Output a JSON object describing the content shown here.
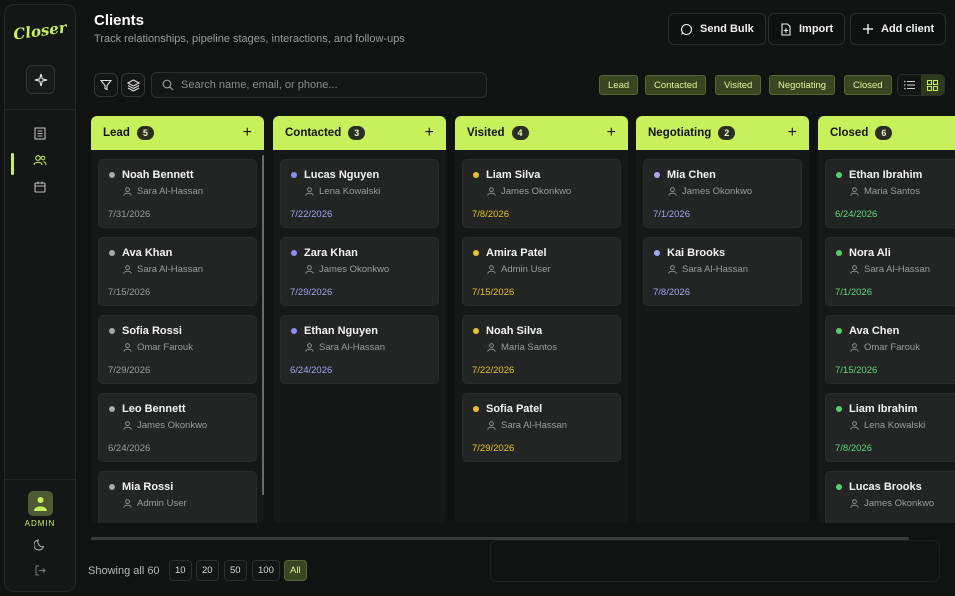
{
  "app": {
    "logo": "Closer"
  },
  "sidebar": {
    "user_role": "ADMIN"
  },
  "header": {
    "title": "Clients",
    "subtitle": "Track relationships, pipeline stages, interactions, and follow-ups",
    "buttons": {
      "send_bulk": "Send Bulk",
      "import": "Import",
      "add_client": "Add client"
    }
  },
  "toolbar": {
    "search_placeholder": "Search name, email, or phone...",
    "filters": [
      "Lead",
      "Contacted",
      "Visited",
      "Negotiating",
      "Closed"
    ]
  },
  "colors": {
    "accent": "#c8f05a",
    "lead": "#a8aaaa",
    "contacted": "#8b8ff0",
    "visited": "#e8c227",
    "negotiating": "#a0a8ee",
    "closed": "#4fd06a"
  },
  "columns": [
    {
      "title": "Lead",
      "count": "5",
      "cards": [
        {
          "name": "Noah Bennett",
          "owner": "Sara Al-Hassan",
          "date": "7/31/2026"
        },
        {
          "name": "Ava Khan",
          "owner": "Sara Al-Hassan",
          "date": "7/15/2026"
        },
        {
          "name": "Sofia Rossi",
          "owner": "Omar Farouk",
          "date": "7/29/2026"
        },
        {
          "name": "Leo Bennett",
          "owner": "James Okonkwo",
          "date": "6/24/2026"
        },
        {
          "name": "Mia Rossi",
          "owner": "Admin User",
          "date": ""
        }
      ]
    },
    {
      "title": "Contacted",
      "count": "3",
      "cards": [
        {
          "name": "Lucas Nguyen",
          "owner": "Lena Kowalski",
          "date": "7/22/2026"
        },
        {
          "name": "Zara Khan",
          "owner": "James Okonkwo",
          "date": "7/29/2026"
        },
        {
          "name": "Ethan Nguyen",
          "owner": "Sara Al-Hassan",
          "date": "6/24/2026"
        }
      ]
    },
    {
      "title": "Visited",
      "count": "4",
      "cards": [
        {
          "name": "Liam Silva",
          "owner": "James Okonkwo",
          "date": "7/8/2026"
        },
        {
          "name": "Amira Patel",
          "owner": "Admin User",
          "date": "7/15/2026"
        },
        {
          "name": "Noah Silva",
          "owner": "Maria Santos",
          "date": "7/22/2026"
        },
        {
          "name": "Sofia Patel",
          "owner": "Sara Al-Hassan",
          "date": "7/29/2026"
        }
      ]
    },
    {
      "title": "Negotiating",
      "count": "2",
      "cards": [
        {
          "name": "Mia Chen",
          "owner": "James Okonkwo",
          "date": "7/1/2026"
        },
        {
          "name": "Kai Brooks",
          "owner": "Sara Al-Hassan",
          "date": "7/8/2026"
        }
      ]
    },
    {
      "title": "Closed",
      "count": "6",
      "cards": [
        {
          "name": "Ethan Ibrahim",
          "owner": "Maria Santos",
          "date": "6/24/2026"
        },
        {
          "name": "Nora Ali",
          "owner": "Sara Al-Hassan",
          "date": "7/1/2026"
        },
        {
          "name": "Ava Chen",
          "owner": "Omar Farouk",
          "date": "7/15/2026"
        },
        {
          "name": "Liam Ibrahim",
          "owner": "Lena Kowalski",
          "date": "7/8/2026"
        },
        {
          "name": "Lucas Brooks",
          "owner": "James Okonkwo",
          "date": ""
        }
      ]
    }
  ],
  "footer": {
    "showing": "Showing all 60",
    "page_sizes": [
      "10",
      "20",
      "50",
      "100",
      "All"
    ],
    "active_page_size": "All"
  }
}
